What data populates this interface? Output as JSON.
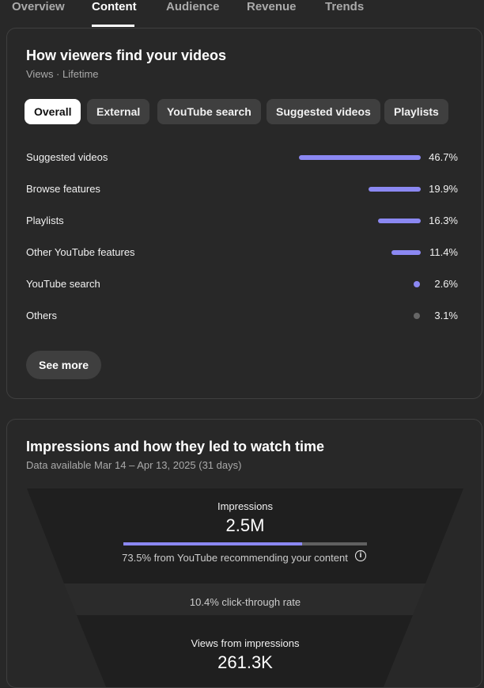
{
  "tabs": [
    "Overview",
    "Content",
    "Audience",
    "Revenue",
    "Trends"
  ],
  "traffic": {
    "title": "How viewers find your videos",
    "subtitle": "Views · Lifetime",
    "chips": [
      "Overall",
      "External",
      "YouTube search",
      "Suggested videos",
      "Playlists"
    ],
    "rows": [
      {
        "label": "Suggested videos",
        "value": "46.7%",
        "pct": 46.7
      },
      {
        "label": "Browse features",
        "value": "19.9%",
        "pct": 19.9
      },
      {
        "label": "Playlists",
        "value": "16.3%",
        "pct": 16.3
      },
      {
        "label": "Other YouTube features",
        "value": "11.4%",
        "pct": 11.4
      },
      {
        "label": "YouTube search",
        "value": "2.6%",
        "pct": 2.6
      },
      {
        "label": "Others",
        "value": "3.1%",
        "pct": 3.1
      }
    ],
    "see_more": "See more"
  },
  "impressions": {
    "title": "Impressions and how they led to watch time",
    "subtitle": "Data available Mar 14 – Apr 13, 2025 (31 days)",
    "impressions_label": "Impressions",
    "impressions_value": "2.5M",
    "recommend_pct": 73.5,
    "recommend_text": "73.5% from YouTube recommending your content",
    "ctr_text": "10.4% click-through rate",
    "views_label": "Views from impressions",
    "views_value": "261.3K"
  },
  "colors": {
    "accent": "#8b88f2",
    "background": "#282828",
    "funnel_dark": "#1f1f1f",
    "funnel_mid": "#2b2b2b",
    "others_gray": "#666666"
  }
}
